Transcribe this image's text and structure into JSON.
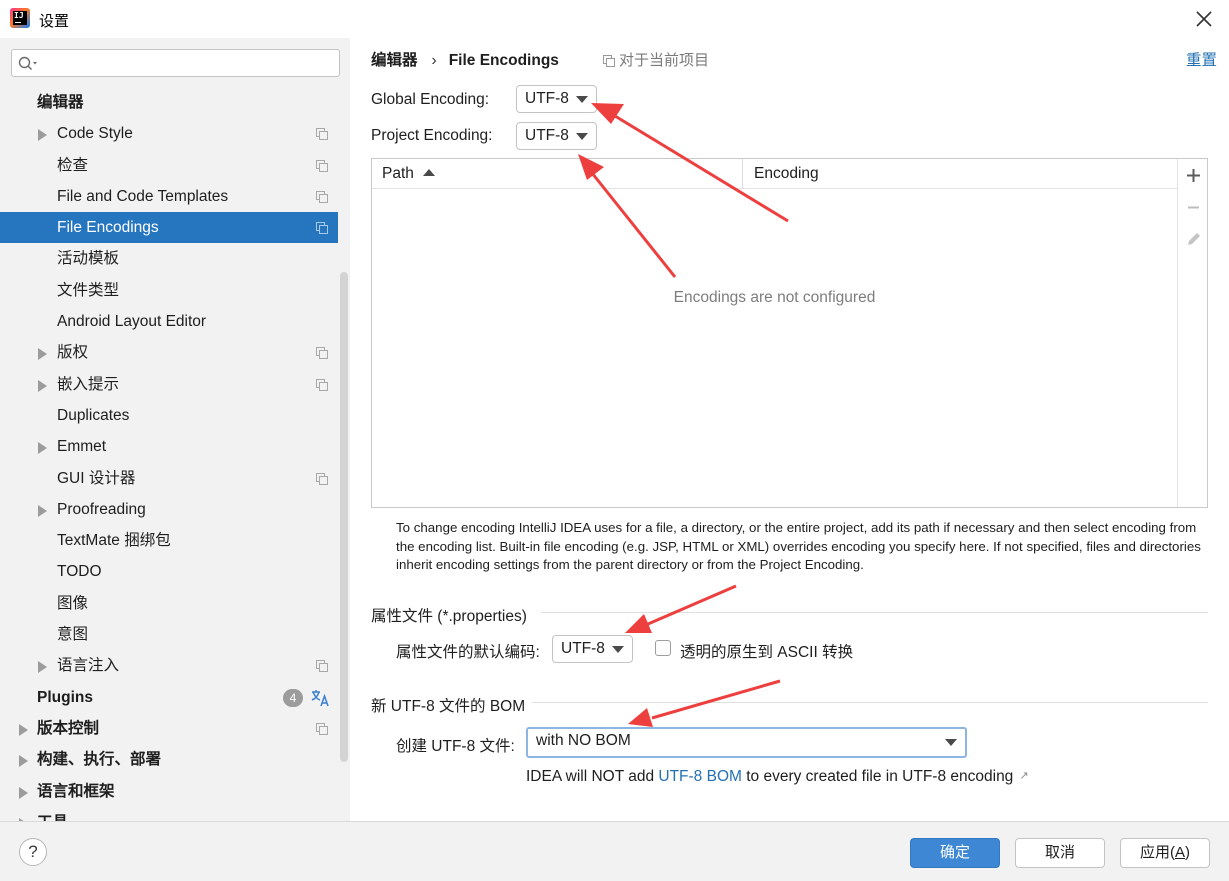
{
  "window": {
    "title": "设置"
  },
  "search": {
    "placeholder": ""
  },
  "sidebar": {
    "items": [
      {
        "label": "编辑器",
        "level": 0,
        "bold": true,
        "arrow": false,
        "project_icon": false
      },
      {
        "label": "Code Style",
        "level": 1,
        "arrow": true,
        "project_icon": true
      },
      {
        "label": "检查",
        "level": 1,
        "arrow": false,
        "project_icon": true
      },
      {
        "label": "File and Code Templates",
        "level": 1,
        "arrow": false,
        "project_icon": true
      },
      {
        "label": "File Encodings",
        "level": 1,
        "arrow": false,
        "project_icon": true,
        "selected": true
      },
      {
        "label": "活动模板",
        "level": 1,
        "arrow": false,
        "project_icon": false
      },
      {
        "label": "文件类型",
        "level": 1,
        "arrow": false,
        "project_icon": false
      },
      {
        "label": "Android Layout Editor",
        "level": 1,
        "arrow": false,
        "project_icon": false
      },
      {
        "label": "版权",
        "level": 1,
        "arrow": true,
        "project_icon": true
      },
      {
        "label": "嵌入提示",
        "level": 1,
        "arrow": true,
        "project_icon": true
      },
      {
        "label": "Duplicates",
        "level": 1,
        "arrow": false,
        "project_icon": false
      },
      {
        "label": "Emmet",
        "level": 1,
        "arrow": true,
        "project_icon": false
      },
      {
        "label": "GUI 设计器",
        "level": 1,
        "arrow": false,
        "project_icon": true
      },
      {
        "label": "Proofreading",
        "level": 1,
        "arrow": true,
        "project_icon": false
      },
      {
        "label": "TextMate 捆绑包",
        "level": 1,
        "arrow": false,
        "project_icon": false
      },
      {
        "label": "TODO",
        "level": 1,
        "arrow": false,
        "project_icon": false
      },
      {
        "label": "图像",
        "level": 1,
        "arrow": false,
        "project_icon": false
      },
      {
        "label": "意图",
        "level": 1,
        "arrow": false,
        "project_icon": false
      },
      {
        "label": "语言注入",
        "level": 1,
        "arrow": true,
        "project_icon": true
      },
      {
        "label": "Plugins",
        "level": 0,
        "bold": true,
        "arrow": false,
        "project_icon": false,
        "badge": "4",
        "translate_icon": true
      },
      {
        "label": "版本控制",
        "level": 0,
        "bold": true,
        "arrow": true,
        "project_icon": true
      },
      {
        "label": "构建、执行、部署",
        "level": 0,
        "bold": true,
        "arrow": true,
        "project_icon": false
      },
      {
        "label": "语言和框架",
        "level": 0,
        "bold": true,
        "arrow": true,
        "project_icon": false
      },
      {
        "label": "工具",
        "level": 0,
        "bold": true,
        "arrow": true,
        "project_icon": false
      }
    ]
  },
  "breadcrumb": {
    "parent": "编辑器",
    "separator": "›",
    "current": "File Encodings",
    "scope": "对于当前项目"
  },
  "reset_label": "重置",
  "global_encoding": {
    "label": "Global Encoding:",
    "value": "UTF-8"
  },
  "project_encoding": {
    "label": "Project Encoding:",
    "value": "UTF-8"
  },
  "table": {
    "columns": [
      "Path",
      "Encoding"
    ],
    "sort_column": "Path",
    "empty_text": "Encodings are not configured",
    "toolbar": [
      "plus-icon",
      "minus-icon",
      "edit-icon"
    ]
  },
  "help_text": "To change encoding IntelliJ IDEA uses for a file, a directory, or the entire project, add its path if necessary and then select encoding from the encoding list. Built-in file encoding (e.g. JSP, HTML or XML) overrides encoding you specify here. If not specified, files and directories inherit encoding settings from the parent directory or from the Project Encoding.",
  "properties_section": {
    "title": "属性文件 (*.properties)",
    "default_label": "属性文件的默认编码:",
    "default_value": "UTF-8",
    "checkbox_label": "透明的原生到 ASCII 转换",
    "checkbox_checked": false
  },
  "bom_section": {
    "title": "新 UTF-8 文件的 BOM",
    "create_label": "创建 UTF-8 文件:",
    "create_value": "with NO BOM",
    "info_prefix": "IDEA will NOT add",
    "info_link": "UTF-8 BOM",
    "info_suffix": "to every created file in UTF-8 encoding",
    "info_arrow": "↗"
  },
  "footer": {
    "help": "?",
    "ok": "确定",
    "cancel": "取消",
    "apply_prefix": "应用(",
    "apply_mnemonic": "A",
    "apply_suffix": ")"
  },
  "colors": {
    "selection": "#2675bf",
    "link": "#2470b3",
    "primary_button": "#3d87d4",
    "annotation_arrow": "#ee3f3f"
  }
}
